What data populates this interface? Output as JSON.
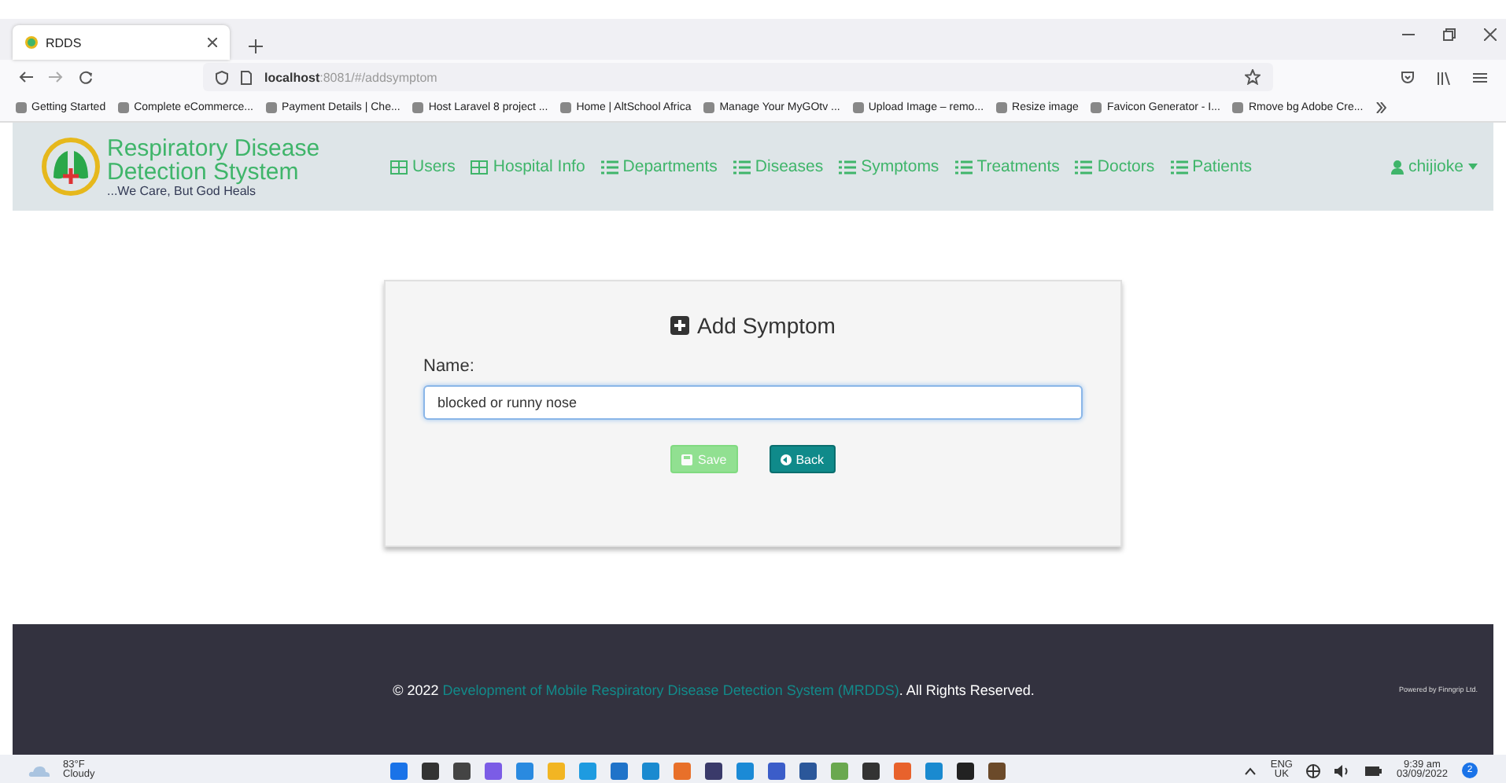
{
  "browser": {
    "tab": {
      "title": "RDDS",
      "selected": true
    },
    "address": {
      "host": "localhost",
      "path": ":8081/#/addsymptom"
    },
    "bookmarks": [
      "Getting Started",
      "Complete eCommerce...",
      "Payment Details | Che...",
      "Host Laravel 8 project ...",
      "Home | AltSchool Africa",
      "Manage Your MyGOtv ...",
      "Upload Image – remo...",
      "Resize image",
      "Favicon Generator - I...",
      "Rmove bg Adobe Cre..."
    ]
  },
  "navbar": {
    "brand": {
      "line1": "Respiratory Disease",
      "line2": "Detection Stystem",
      "tagline": "...We Care, But God Heals"
    },
    "items": [
      {
        "label": "Users",
        "kind": "grid"
      },
      {
        "label": "Hospital Info",
        "kind": "grid"
      },
      {
        "label": "Departments",
        "kind": "list"
      },
      {
        "label": "Diseases",
        "kind": "list"
      },
      {
        "label": "Symptoms",
        "kind": "list"
      },
      {
        "label": "Treatments",
        "kind": "list"
      },
      {
        "label": "Doctors",
        "kind": "list"
      },
      {
        "label": "Patients",
        "kind": "list"
      }
    ],
    "user": "chijioke"
  },
  "form": {
    "title": "Add Symptom",
    "field_label": "Name:",
    "value": "blocked or runny nose",
    "buttons": [
      {
        "label": "Save",
        "kind": "save",
        "disabled": true
      },
      {
        "label": "Back",
        "kind": "back",
        "disabled": false
      }
    ]
  },
  "footer": {
    "prefix": "© 2022",
    "link": "Development of Mobile Respiratory Disease Detection System (MRDDS)",
    "suffix": ". All Rights Reserved.",
    "powered": "Powered by Finngrip Ltd."
  },
  "taskbar": {
    "temperature": "83°F",
    "weather": "Cloudy",
    "language": "ENG",
    "region": "UK",
    "time": "9:39 am",
    "date": "03/09/2022",
    "notifications": "2"
  }
}
